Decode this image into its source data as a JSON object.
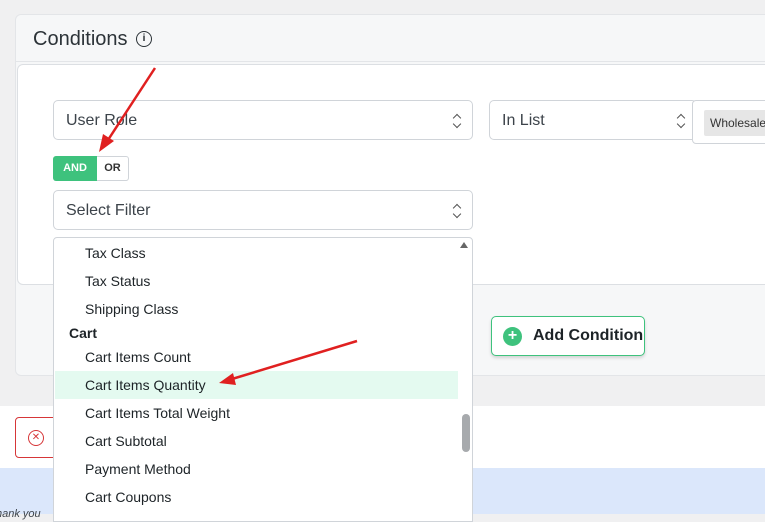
{
  "panel": {
    "title": "Conditions",
    "info_icon": "info-icon"
  },
  "row1": {
    "field": "User Role",
    "operator": "In List",
    "tag": "Wholesale"
  },
  "toggle": {
    "and_label": "AND",
    "or_label": "OR",
    "active": "AND"
  },
  "filter": {
    "placeholder": "Select Filter"
  },
  "dropdown": {
    "items": [
      {
        "label": "Tax Class"
      },
      {
        "label": "Tax Status"
      },
      {
        "label": "Shipping Class"
      }
    ],
    "group": "Cart",
    "group_items": [
      {
        "label": "Cart Items Count"
      },
      {
        "label": "Cart Items Quantity",
        "highlighted": true
      },
      {
        "label": "Cart Items Total Weight"
      },
      {
        "label": "Cart Subtotal"
      },
      {
        "label": "Payment Method"
      },
      {
        "label": "Cart Coupons"
      }
    ]
  },
  "add_condition": {
    "label": "Add Condition",
    "icon": "plus-circle-icon"
  },
  "cancel": {
    "icon": "close-circle-icon"
  },
  "footer": {
    "text": "hank you"
  },
  "colors": {
    "accent": "#3ec27d",
    "danger": "#d63638",
    "arrow": "#e02020",
    "highlight": "#e4faf0"
  }
}
